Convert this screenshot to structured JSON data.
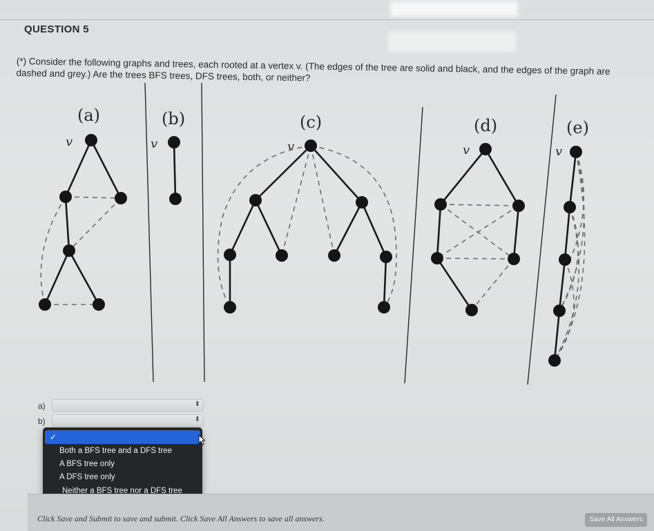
{
  "question": {
    "title": "QUESTION 5",
    "prompt": "(*) Consider the following graphs and trees, each rooted at a vertex v. (The edges of the tree are solid and black, and the edges of the graph are dashed and grey.) Are the trees BFS trees, DFS trees, both, or neither?"
  },
  "graphs": {
    "a": {
      "label": "(a)",
      "root": "v"
    },
    "b": {
      "label": "(b)",
      "root": "v"
    },
    "c": {
      "label": "(c)",
      "root": "v"
    },
    "d": {
      "label": "(d)",
      "root": "v"
    },
    "e": {
      "label": "(e)",
      "root": "v"
    }
  },
  "answers": [
    {
      "label": "a)",
      "value": ""
    },
    {
      "label": "b)",
      "value": ""
    }
  ],
  "dropdown": {
    "check": "✓",
    "options": [
      "Both a BFS tree and a DFS tree",
      "A BFS tree only",
      "A DFS tree only",
      "Neither a BFS tree nor a DFS tree"
    ]
  },
  "footer": {
    "instructions": "Click Save and Submit to save and submit. Click Save All Answers to save all answers.",
    "save_all_label": "Save All Answers"
  }
}
